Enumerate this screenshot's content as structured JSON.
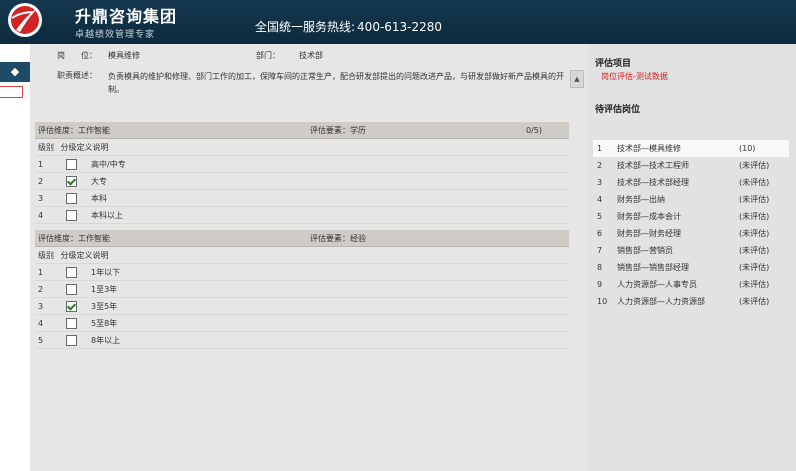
{
  "header": {
    "company": "升鼎咨询集团",
    "slogan": "卓越绩效管理专家",
    "hotline_label": "全国统一服务热线:",
    "hotline_number": "400-613-2280"
  },
  "left_nav": {
    "icon": "diamond-icon"
  },
  "info": {
    "position_label": "岗　　位：",
    "position_value": "模具维修",
    "dept_label": "部门：",
    "dept_value": "技术部",
    "desc_label": "职责概述：",
    "desc_value": "负责模具的维护和修理、部门工作的加工，保障车间的正常生产，配合研发部提出的问题改进产品，与研发部做好新产品模具的开制。",
    "scroll_icon": "scroll-up-icon"
  },
  "section1": {
    "dimension": "评估维度：工作智能",
    "factor": "评估要素：学历",
    "score": "0/5)",
    "col_level": "级别",
    "col_desc": "分级定义说明",
    "rows": [
      {
        "level": "1",
        "desc": "高中/中专",
        "checked": false
      },
      {
        "level": "2",
        "desc": "大专",
        "checked": true
      },
      {
        "level": "3",
        "desc": "本科",
        "checked": false
      },
      {
        "level": "4",
        "desc": "本科以上",
        "checked": false
      }
    ]
  },
  "section2": {
    "dimension": "评估维度：工作智能",
    "factor": "评估要素：经验",
    "col_level": "级别",
    "col_desc": "分级定义说明",
    "rows": [
      {
        "level": "1",
        "desc": "1年以下",
        "checked": false
      },
      {
        "level": "2",
        "desc": "1至3年",
        "checked": false
      },
      {
        "level": "3",
        "desc": "3至5年",
        "checked": true
      },
      {
        "level": "4",
        "desc": "5至8年",
        "checked": false
      },
      {
        "level": "5",
        "desc": "8年以上",
        "checked": false
      }
    ]
  },
  "right_panel": {
    "project_title": "评估项目",
    "current_project": "岗位评估-测试数据",
    "positions_title": "待评估岗位",
    "positions": [
      {
        "num": "1",
        "name": "技术部—模具维修",
        "status": "(10)",
        "active": true
      },
      {
        "num": "2",
        "name": "技术部—技术工程师",
        "status": "(未评估)"
      },
      {
        "num": "3",
        "name": "技术部—技术部经理",
        "status": "(未评估)"
      },
      {
        "num": "4",
        "name": "财务部—出纳",
        "status": "(未评估)"
      },
      {
        "num": "5",
        "name": "财务部—成本会计",
        "status": "(未评估)"
      },
      {
        "num": "6",
        "name": "财务部—财务经理",
        "status": "(未评估)"
      },
      {
        "num": "7",
        "name": "销售部—营销员",
        "status": "(未评估)"
      },
      {
        "num": "8",
        "name": "销售部—销售部经理",
        "status": "(未评估)"
      },
      {
        "num": "9",
        "name": "人力资源部—人事专员",
        "status": "(未评估)"
      },
      {
        "num": "10",
        "name": "人力资源部—人力资源部",
        "status": "(未评估)"
      }
    ]
  },
  "colors": {
    "header_bg": "#0d2a3e",
    "accent_red": "#d21f1f",
    "check_green": "#2a7d2a"
  }
}
